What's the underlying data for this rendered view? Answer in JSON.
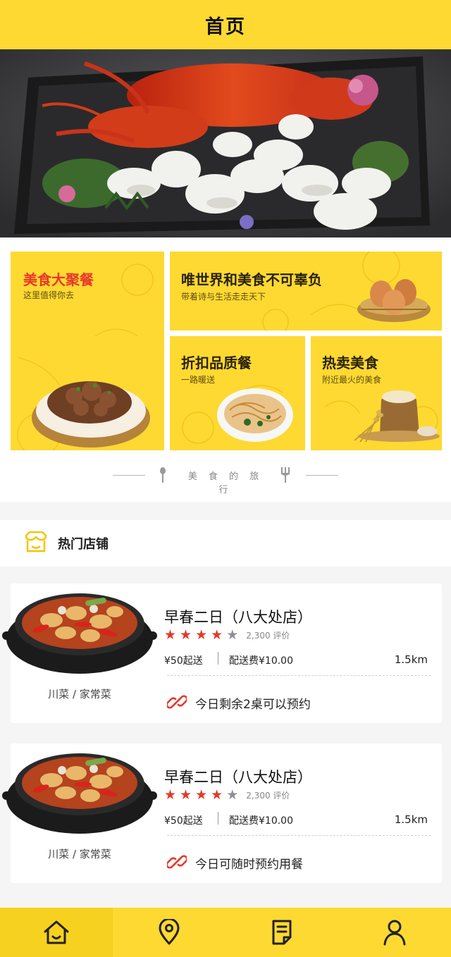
{
  "header": {
    "title": "首页"
  },
  "banner": {
    "image": "lobster-sashimi-platter"
  },
  "promo": {
    "cards": [
      {
        "title": "美食大聚餐",
        "subtitle": "这里值得你去",
        "title_color": "#e8372b"
      },
      {
        "title": "唯世界和美食不可辜负",
        "subtitle": "带着诗与生活走走天下"
      },
      {
        "title": "折扣品质餐",
        "subtitle": "一路暖送"
      },
      {
        "title": "热卖美食",
        "subtitle": "附近最火的美食"
      }
    ],
    "divider_text": "美 食 的 旅 行"
  },
  "section": {
    "title": "热门店铺",
    "icon": "shop-icon"
  },
  "shops": [
    {
      "name": "早春二日（八大处店）",
      "rating": 4,
      "reviews": "2,300 评价",
      "min_order": "¥50起送",
      "delivery_fee": "配送费¥10.00",
      "distance": "1.5km",
      "category": "川菜 / 家常菜",
      "note": "今日剩余2桌可以预约"
    },
    {
      "name": "早春二日（八大处店）",
      "rating": 4,
      "reviews": "2,300 评价",
      "min_order": "¥50起送",
      "delivery_fee": "配送费¥10.00",
      "distance": "1.5km",
      "category": "川菜 / 家常菜",
      "note": "今日可随时预约用餐"
    }
  ],
  "tabbar": {
    "items": [
      {
        "icon": "home-icon",
        "active": true
      },
      {
        "icon": "location-icon",
        "active": false
      },
      {
        "icon": "order-icon",
        "active": false
      },
      {
        "icon": "user-icon",
        "active": false
      }
    ]
  },
  "colors": {
    "brand_yellow": "#fed932",
    "accent_red": "#e8372b",
    "star_gray": "#8e8e96"
  }
}
